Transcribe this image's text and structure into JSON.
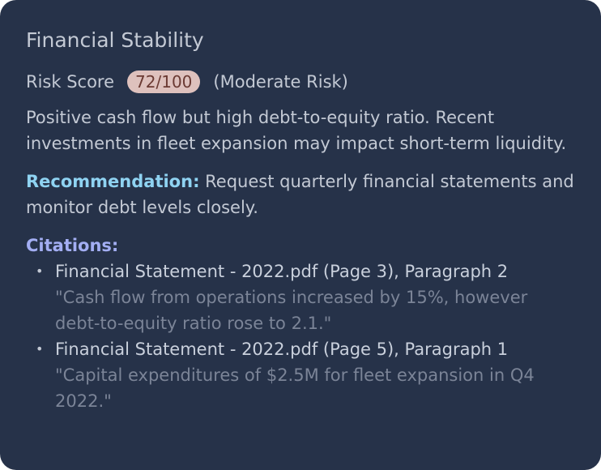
{
  "card": {
    "title": "Financial Stability",
    "risk_label": "Risk Score",
    "risk_score": "72/100",
    "risk_level": "(Moderate Risk)",
    "summary": "Positive cash flow but high debt-to-equity ratio. Recent investments in fleet expansion may impact short-term liquidity.",
    "recommendation_label": "Recommendation:",
    "recommendation_text": "Request quarterly financial statements and monitor debt levels closely.",
    "citations_heading": "Citations:",
    "citations": [
      {
        "source": "Financial Statement - 2022.pdf (Page 3), Paragraph 2",
        "quote": "\"Cash flow from operations increased by 15%, however debt-to-equity ratio rose to 2.1.\""
      },
      {
        "source": "Financial Statement - 2022.pdf (Page 5), Paragraph 1",
        "quote": "\"Capital expenditures of $2.5M for fleet expansion in Q4 2022.\""
      }
    ]
  },
  "colors": {
    "card_background": "#263249",
    "badge_background": "#dec1bd",
    "recommendation_label": "#8fd3f2",
    "citations_heading": "#a3aef3",
    "quote_text": "#7b8497"
  }
}
